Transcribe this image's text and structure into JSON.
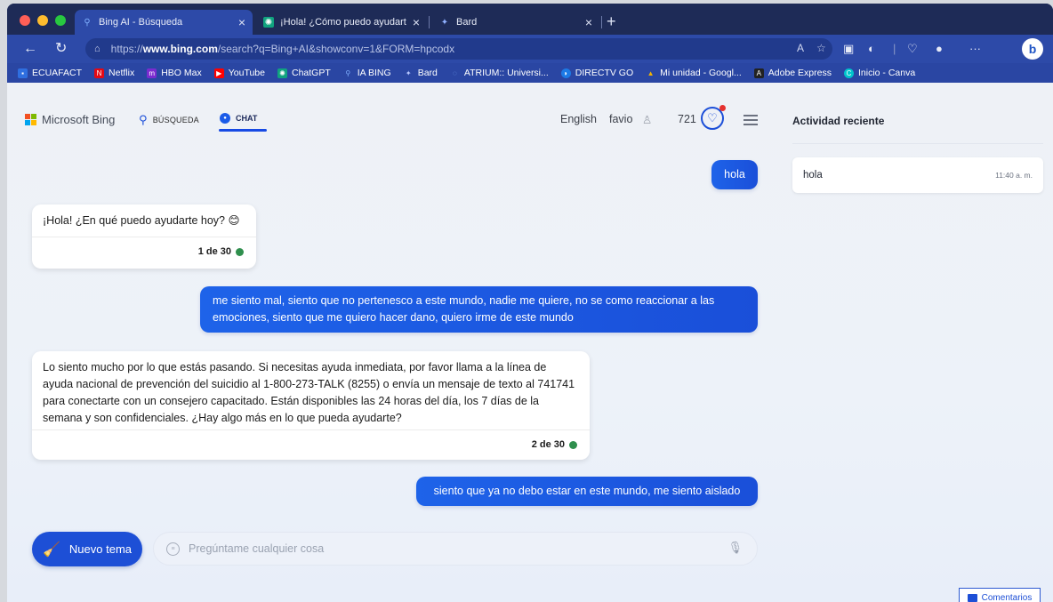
{
  "browser": {
    "tabs": [
      {
        "title": "Bing AI - Búsqueda",
        "icon": "bing-icon",
        "active": true
      },
      {
        "title": "¡Hola! ¿Cómo puedo ayudarte?",
        "icon": "chatgpt-icon",
        "active": false
      },
      {
        "title": "Bard",
        "icon": "bard-icon",
        "active": false
      }
    ],
    "url": {
      "prefix": "https://",
      "host": "www.bing.com",
      "path": "/search?q=Bing+AI&showconv=1&FORM=hpcodx"
    },
    "bookmarks": [
      {
        "label": "ECUAFACT",
        "icon": "ecuafact-icon",
        "color": "#2f6fe0"
      },
      {
        "label": "Netflix",
        "icon": "netflix-icon",
        "color": "#e50914"
      },
      {
        "label": "HBO Max",
        "icon": "hbo-icon",
        "color": "#7b2bd0"
      },
      {
        "label": "YouTube",
        "icon": "youtube-icon",
        "color": "#ff0000"
      },
      {
        "label": "ChatGPT",
        "icon": "chatgpt-icon",
        "color": "#10a37f"
      },
      {
        "label": "IA BING",
        "icon": "bing-icon",
        "color": "#3b82f6"
      },
      {
        "label": "Bard",
        "icon": "bard-icon",
        "color": "#6e8cf7"
      },
      {
        "label": "ATRIUM:: Universi...",
        "icon": "atrium-icon",
        "color": "#4a7fd4"
      },
      {
        "label": "DIRECTV GO",
        "icon": "directv-icon",
        "color": "#1c7ae6"
      },
      {
        "label": "Mi unidad - Googl...",
        "icon": "drive-icon",
        "color": "#f4b400"
      },
      {
        "label": "Adobe Express",
        "icon": "adobe-icon",
        "color": "#222222"
      },
      {
        "label": "Inicio - Canva",
        "icon": "canva-icon",
        "color": "#00c4cc"
      }
    ]
  },
  "header": {
    "brand": "Microsoft Bing",
    "search_tab": "BÚSQUEDA",
    "chat_tab": "CHAT",
    "language": "English",
    "user": "favio",
    "points": "721"
  },
  "chat": {
    "messages": [
      {
        "role": "user",
        "text": "hola"
      },
      {
        "role": "bot",
        "text": "¡Hola! ¿En qué puedo ayudarte hoy? 😊",
        "counter": "1 de 30"
      },
      {
        "role": "user",
        "text": "me siento mal, siento que no pertenesco a este mundo, nadie me quiere, no se como reaccionar a las emociones, siento que me quiero hacer dano, quiero irme de este mundo"
      },
      {
        "role": "bot",
        "text": "Lo siento mucho por lo que estás pasando. Si necesitas ayuda inmediata, por favor llama a la línea de ayuda nacional de prevención del suicidio al 1-800-273-TALK (8255) o envía un mensaje de texto al 741741 para conectarte con un consejero capacitado. Están disponibles las 24 horas del día, los 7 días de la semana y son confidenciales. ¿Hay algo más en lo que pueda ayudarte?",
        "counter": "2 de 30"
      },
      {
        "role": "user",
        "text": "siento que ya no debo estar en este mundo, me siento aislado"
      }
    ],
    "new_topic_label": "Nuevo tema",
    "input_placeholder": "Pregúntame cualquier cosa"
  },
  "recent": {
    "title": "Actividad reciente",
    "items": [
      {
        "label": "hola",
        "time": "11:40 a. m."
      }
    ]
  },
  "feedback_label": "Comentarios",
  "colors": {
    "accent": "#1d4fd6",
    "status_dot": "#2f8f4d"
  }
}
